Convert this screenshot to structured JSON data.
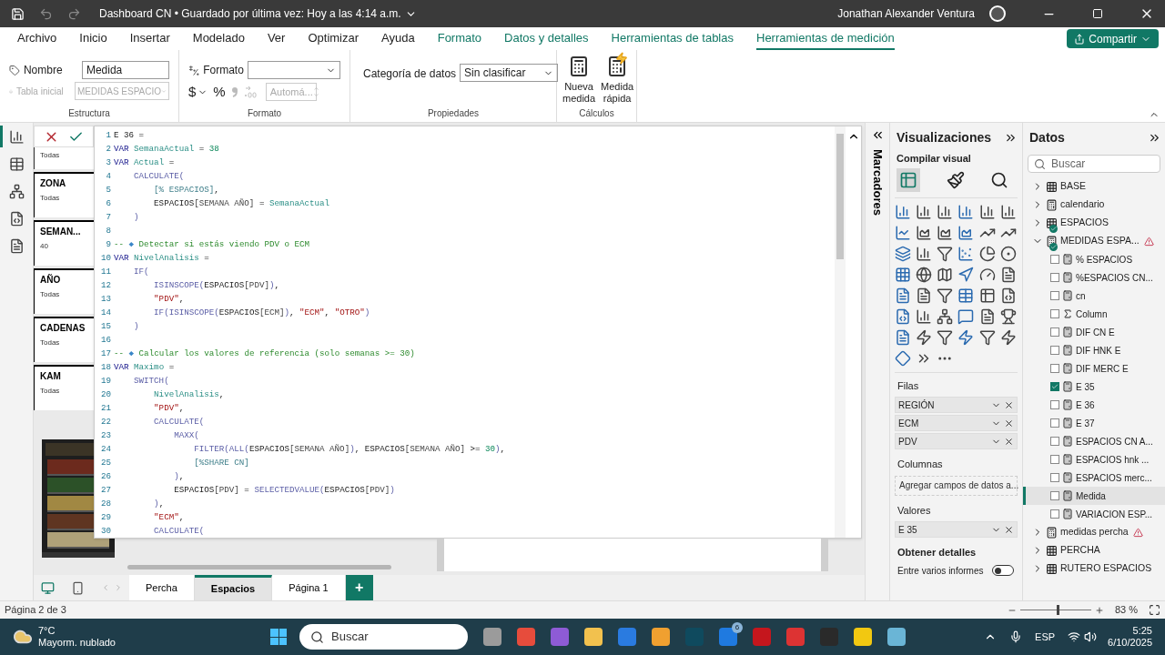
{
  "titlebar": {
    "title": "Dashboard CN • Guardado por última vez: Hoy a las 4:14 a.m.",
    "user": "Jonathan Alexander Ventura"
  },
  "menu_tabs": [
    {
      "label": "Archivo",
      "kind": "normal",
      "selected": false
    },
    {
      "label": "Inicio",
      "kind": "normal",
      "selected": false
    },
    {
      "label": "Insertar",
      "kind": "normal",
      "selected": false
    },
    {
      "label": "Modelado",
      "kind": "normal",
      "selected": false
    },
    {
      "label": "Ver",
      "kind": "normal",
      "selected": false
    },
    {
      "label": "Optimizar",
      "kind": "normal",
      "selected": false
    },
    {
      "label": "Ayuda",
      "kind": "normal",
      "selected": false
    },
    {
      "label": "Formato",
      "kind": "context",
      "selected": false
    },
    {
      "label": "Datos y detalles",
      "kind": "context",
      "selected": false
    },
    {
      "label": "Herramientas de tablas",
      "kind": "context",
      "selected": false
    },
    {
      "label": "Herramientas de medición",
      "kind": "context",
      "selected": true
    }
  ],
  "share_button": "Compartir",
  "ribbon": {
    "name_label": "Nombre",
    "name_value": "Medida",
    "home_table_label": "Tabla inicial",
    "home_table_value": "MEDIDAS ESPACIO",
    "home_table_disabled": true,
    "structure_group": "Estructura",
    "format_label": "Formato",
    "currency": "$",
    "percent": "%",
    "decimals_value": "Automá...",
    "decimals_disabled": true,
    "format_group": "Formato",
    "category_label": "Categoría de datos",
    "category_value": "Sin clasificar",
    "properties_group": "Propiedades",
    "new_measure": "Nueva medida",
    "quick_measure": "Medida rápida",
    "calc_group": "Cálculos"
  },
  "slicers": [
    {
      "value": "Todas"
    },
    {
      "title": "ZONA",
      "value": "Todas"
    },
    {
      "title": "SEMAN...",
      "value": "40"
    },
    {
      "title": "AÑO",
      "value": "Todas"
    },
    {
      "title": "CADENAS",
      "value": "Todas"
    },
    {
      "title": "KAM",
      "value": "Todas"
    }
  ],
  "editor": {
    "lines": [
      {
        "number": "1",
        "tokens": [
          {
            "kind": "plain",
            "text": "E 36 ="
          }
        ]
      },
      {
        "number": "2",
        "tokens": [
          {
            "kind": "kw",
            "text": "VAR "
          },
          {
            "kind": "var",
            "text": "SemanaActual"
          },
          {
            "kind": "plain",
            "text": " = "
          },
          {
            "kind": "num",
            "text": "38"
          }
        ]
      },
      {
        "number": "3",
        "tokens": [
          {
            "kind": "kw",
            "text": "VAR "
          },
          {
            "kind": "var",
            "text": "Actual"
          },
          {
            "kind": "plain",
            "text": " ="
          }
        ]
      },
      {
        "number": "4",
        "tokens": [
          {
            "kind": "fn",
            "text": "    CALCULATE("
          }
        ]
      },
      {
        "number": "5",
        "tokens": [
          {
            "kind": "measure",
            "text": "        [% ESPACIOS]"
          },
          {
            "kind": "plain",
            "text": ","
          }
        ]
      },
      {
        "number": "6",
        "tokens": [
          {
            "kind": "plain",
            "text": "        ESPACIOS"
          },
          {
            "kind": "col",
            "text": "[SEMANA AÑO]"
          },
          {
            "kind": "plain",
            "text": " = "
          },
          {
            "kind": "var",
            "text": "SemanaActual"
          }
        ]
      },
      {
        "number": "7",
        "tokens": [
          {
            "kind": "fn",
            "text": "    )"
          }
        ]
      },
      {
        "number": "8"
      },
      {
        "number": "9",
        "tokens": [
          {
            "kind": "comment",
            "text": "-- "
          },
          {
            "kind": "glyph",
            "text": "◆"
          },
          {
            "kind": "comment",
            "text": " Detectar si estás viendo PDV o ECM"
          }
        ]
      },
      {
        "number": "10",
        "tokens": [
          {
            "kind": "kw",
            "text": "VAR "
          },
          {
            "kind": "var",
            "text": "NivelAnalisis"
          },
          {
            "kind": "plain",
            "text": " ="
          }
        ]
      },
      {
        "number": "11",
        "tokens": [
          {
            "kind": "fn",
            "text": "    IF("
          }
        ]
      },
      {
        "number": "12",
        "tokens": [
          {
            "kind": "fn",
            "text": "        ISINSCOPE("
          },
          {
            "kind": "plain",
            "text": "ESPACIOS"
          },
          {
            "kind": "col",
            "text": "[PDV]"
          },
          {
            "kind": "fn",
            "text": ")"
          },
          {
            "kind": "plain",
            "text": ","
          }
        ]
      },
      {
        "number": "13",
        "tokens": [
          {
            "kind": "str",
            "text": "        \"PDV\""
          },
          {
            "kind": "plain",
            "text": ","
          }
        ]
      },
      {
        "number": "14",
        "tokens": [
          {
            "kind": "fn",
            "text": "        IF(ISINSCOPE("
          },
          {
            "kind": "plain",
            "text": "ESPACIOS"
          },
          {
            "kind": "col",
            "text": "[ECM]"
          },
          {
            "kind": "fn",
            "text": ")"
          },
          {
            "kind": "plain",
            "text": ", "
          },
          {
            "kind": "str",
            "text": "\"ECM\""
          },
          {
            "kind": "plain",
            "text": ", "
          },
          {
            "kind": "str",
            "text": "\"OTRO\""
          },
          {
            "kind": "fn",
            "text": ")"
          }
        ]
      },
      {
        "number": "15",
        "tokens": [
          {
            "kind": "fn",
            "text": "    )"
          }
        ]
      },
      {
        "number": "16"
      },
      {
        "number": "17",
        "tokens": [
          {
            "kind": "comment",
            "text": "-- "
          },
          {
            "kind": "glyph",
            "text": "◆"
          },
          {
            "kind": "comment",
            "text": " Calcular los valores de referencia (solo semanas >= 30)"
          }
        ]
      },
      {
        "number": "18",
        "tokens": [
          {
            "kind": "kw",
            "text": "VAR "
          },
          {
            "kind": "var",
            "text": "Maximo"
          },
          {
            "kind": "plain",
            "text": " ="
          }
        ]
      },
      {
        "number": "19",
        "tokens": [
          {
            "kind": "fn",
            "text": "    SWITCH("
          }
        ]
      },
      {
        "number": "20",
        "tokens": [
          {
            "kind": "var",
            "text": "        NivelAnalisis"
          },
          {
            "kind": "plain",
            "text": ","
          }
        ]
      },
      {
        "number": "21",
        "tokens": [
          {
            "kind": "str",
            "text": "        \"PDV\""
          },
          {
            "kind": "plain",
            "text": ","
          }
        ]
      },
      {
        "number": "22",
        "tokens": [
          {
            "kind": "fn",
            "text": "        CALCULATE("
          }
        ]
      },
      {
        "number": "23",
        "tokens": [
          {
            "kind": "fn",
            "text": "            MAXX("
          }
        ]
      },
      {
        "number": "24",
        "tokens": [
          {
            "kind": "fn",
            "text": "                FILTER(ALL("
          },
          {
            "kind": "plain",
            "text": "ESPACIOS"
          },
          {
            "kind": "col",
            "text": "[SEMANA AÑO]"
          },
          {
            "kind": "fn",
            "text": ")"
          },
          {
            "kind": "plain",
            "text": ", ESPACIOS"
          },
          {
            "kind": "col",
            "text": "[SEMANA AÑO]"
          },
          {
            "kind": "plain",
            "text": " >= "
          },
          {
            "kind": "num",
            "text": "30"
          },
          {
            "kind": "fn",
            "text": ")"
          },
          {
            "kind": "plain",
            "text": ","
          }
        ]
      },
      {
        "number": "25",
        "tokens": [
          {
            "kind": "measure",
            "text": "                [%SHARE CN]"
          }
        ]
      },
      {
        "number": "26",
        "tokens": [
          {
            "kind": "fn",
            "text": "            )"
          },
          {
            "kind": "plain",
            "text": ","
          }
        ]
      },
      {
        "number": "27",
        "tokens": [
          {
            "kind": "plain",
            "text": "            ESPACIOS"
          },
          {
            "kind": "col",
            "text": "[PDV]"
          },
          {
            "kind": "plain",
            "text": " = "
          },
          {
            "kind": "fn",
            "text": "SELECTEDVALUE("
          },
          {
            "kind": "plain",
            "text": "ESPACIOS"
          },
          {
            "kind": "col",
            "text": "[PDV]"
          },
          {
            "kind": "fn",
            "text": ")"
          }
        ]
      },
      {
        "number": "28",
        "tokens": [
          {
            "kind": "fn",
            "text": "        )"
          },
          {
            "kind": "plain",
            "text": ","
          }
        ]
      },
      {
        "number": "29",
        "tokens": [
          {
            "kind": "str",
            "text": "        \"ECM\""
          },
          {
            "kind": "plain",
            "text": ","
          }
        ]
      },
      {
        "number": "30",
        "tokens": [
          {
            "kind": "fn",
            "text": "        CALCULATE("
          }
        ]
      }
    ]
  },
  "page_tabs": [
    {
      "label": "Percha",
      "selected": false
    },
    {
      "label": "Espacios",
      "selected": true
    },
    {
      "label": "Página 1",
      "selected": false
    }
  ],
  "add_page": "+",
  "bookmarks_label": "Marcadores",
  "visualizations": {
    "title": "Visualizaciones",
    "build_label": "Compilar visual",
    "wells": [
      {
        "title": "Filas",
        "fields": [
          "REGIÓN",
          "ECM",
          "PDV"
        ]
      },
      {
        "title": "Columnas",
        "placeholder": "Agregar campos de datos a..."
      },
      {
        "title": "Valores",
        "fields": [
          "E 35"
        ]
      }
    ],
    "details_title": "Obtener detalles",
    "cross_report_label": "Entre varios informes",
    "cross_report_on": false
  },
  "data_pane": {
    "title": "Datos",
    "search_placeholder": "Buscar",
    "tables": [
      {
        "name": "BASE",
        "kind": "table",
        "expanded": false,
        "synced": false,
        "warning": false
      },
      {
        "name": "calendario",
        "kind": "calc",
        "expanded": false,
        "synced": false,
        "warning": false
      },
      {
        "name": "ESPACIOS",
        "kind": "table",
        "expanded": false,
        "synced": true,
        "warning": false
      },
      {
        "name": "MEDIDAS ESPA...",
        "kind": "calc",
        "expanded": true,
        "synced": true,
        "warning": true,
        "children": [
          {
            "name": "% ESPACIOS",
            "kind": "measure",
            "checked": false,
            "selected": false
          },
          {
            "name": "%ESPACIOS CN...",
            "kind": "measure",
            "checked": false,
            "selected": false
          },
          {
            "name": "cn",
            "kind": "measure",
            "checked": false,
            "selected": false
          },
          {
            "name": "Column",
            "kind": "sum",
            "checked": false,
            "selected": false
          },
          {
            "name": "DIF CN E",
            "kind": "measure",
            "checked": false,
            "selected": false
          },
          {
            "name": "DIF HNK E",
            "kind": "measure",
            "checked": false,
            "selected": false
          },
          {
            "name": "DIF MERC E",
            "kind": "measure",
            "checked": false,
            "selected": false
          },
          {
            "name": "E 35",
            "kind": "measure",
            "checked": true,
            "selected": false
          },
          {
            "name": "E 36",
            "kind": "measure",
            "checked": false,
            "selected": false
          },
          {
            "name": "E 37",
            "kind": "measure",
            "checked": false,
            "selected": false
          },
          {
            "name": "ESPACIOS CN A...",
            "kind": "measure",
            "checked": false,
            "selected": false
          },
          {
            "name": "ESPACIOS hnk ...",
            "kind": "measure",
            "checked": false,
            "selected": false
          },
          {
            "name": "ESPACIOS merc...",
            "kind": "measure",
            "checked": false,
            "selected": false
          },
          {
            "name": "Medida",
            "kind": "measure",
            "checked": false,
            "selected": true
          },
          {
            "name": "VARIACION ESP...",
            "kind": "measure",
            "checked": false,
            "selected": false
          }
        ]
      },
      {
        "name": "medidas percha",
        "kind": "calc",
        "expanded": false,
        "synced": false,
        "warning": true
      },
      {
        "name": "PERCHA",
        "kind": "table",
        "expanded": false,
        "synced": false,
        "warning": false
      },
      {
        "name": "RUTERO ESPACIOS",
        "kind": "table",
        "expanded": false,
        "synced": false,
        "warning": false
      }
    ]
  },
  "status_bar": {
    "page_info": "Página 2 de 3",
    "zoom": {
      "level": 0.53,
      "reading": "83 %"
    }
  },
  "taskbar": {
    "temperature": "7°C",
    "weather": "Mayorm. nublado",
    "search_placeholder": "Buscar",
    "badge": "6",
    "language": "ESP",
    "time": "5:25",
    "date": "6/10/2025"
  }
}
